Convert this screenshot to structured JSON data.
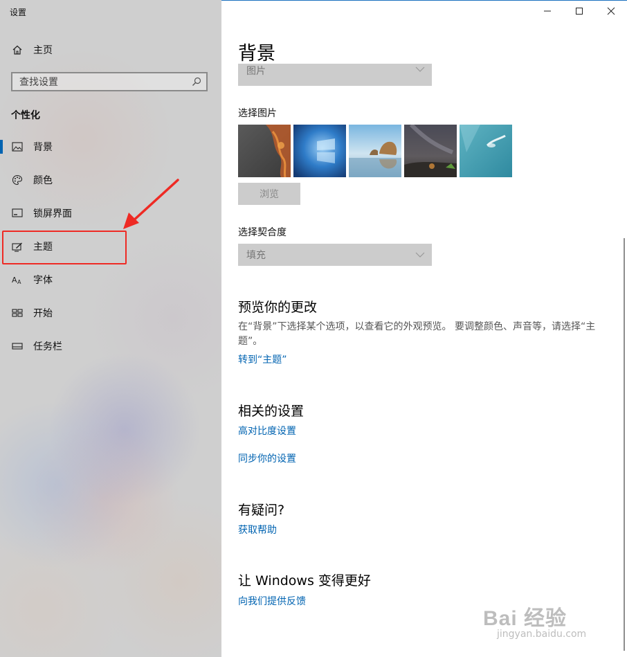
{
  "window": {
    "title": "设置",
    "minimize_symbol": "—",
    "maximize_symbol": "☐",
    "close_symbol": "✕"
  },
  "sidebar": {
    "home_label": "主页",
    "search_placeholder": "查找设置",
    "section_title": "个性化",
    "items": [
      {
        "label": "背景",
        "icon": "image-icon",
        "active": true
      },
      {
        "label": "颜色",
        "icon": "palette-icon"
      },
      {
        "label": "锁屏界面",
        "icon": "lock-screen-icon"
      },
      {
        "label": "主题",
        "icon": "theme-icon"
      },
      {
        "label": "字体",
        "icon": "font-icon"
      },
      {
        "label": "开始",
        "icon": "start-icon"
      },
      {
        "label": "任务栏",
        "icon": "taskbar-icon"
      }
    ]
  },
  "main": {
    "page_title": "背景",
    "background_dropdown_value": "图片",
    "choose_picture_label": "选择图片",
    "browse_button": "浏览",
    "choose_fit_label": "选择契合度",
    "fit_dropdown_value": "填充",
    "preview": {
      "title": "预览你的更改",
      "description": "在“背景”下选择某个选项，以查看它的外观预览。 要调整颜色、声音等，请选择“主题”。",
      "link": "转到“主题”"
    },
    "related": {
      "title": "相关的设置",
      "links": [
        "高对比度设置",
        "同步你的设置"
      ]
    },
    "question": {
      "title": "有疑问?",
      "link": "获取帮助"
    },
    "improve": {
      "title": "让 Windows 变得更好",
      "link": "向我们提供反馈"
    }
  },
  "colors": {
    "accent": "#0063b1",
    "annotation": "#ee2a24"
  },
  "watermark": {
    "text": "Bai 经验",
    "sub": "jingyan.baidu.com"
  }
}
